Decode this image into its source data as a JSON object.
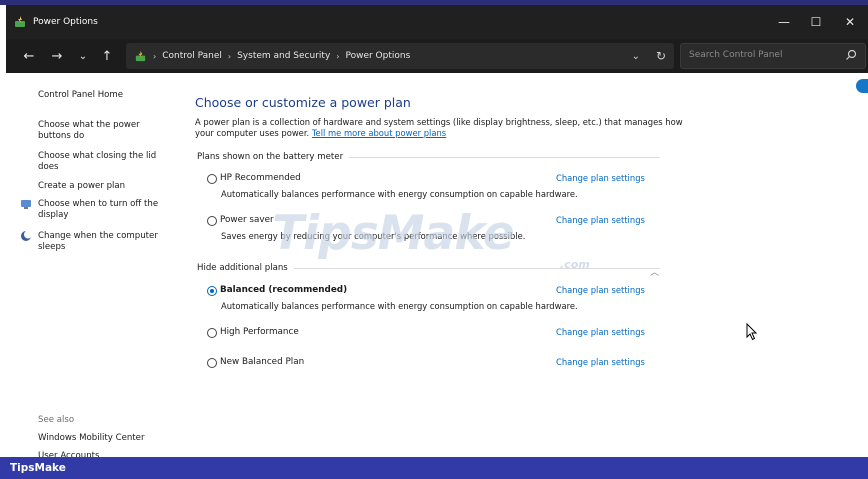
{
  "window": {
    "title": "Power Options",
    "min_glyph": "—",
    "max_glyph": "☐",
    "close_glyph": "✕"
  },
  "address_bar": {
    "breadcrumbs": [
      "Control Panel",
      "System and Security",
      "Power Options"
    ],
    "search_placeholder": "Search Control Panel"
  },
  "sidebar": {
    "home": "Control Panel Home",
    "links": [
      "Choose what the power buttons do",
      "Choose what closing the lid does",
      "Create a power plan",
      "Choose when to turn off the display",
      "Change when the computer sleeps"
    ],
    "see_also": "See also",
    "see_also_links": [
      "Windows Mobility Center",
      "User Accounts"
    ]
  },
  "main": {
    "title": "Choose or customize a power plan",
    "description": "A power plan is a collection of hardware and system settings (like display brightness, sleep, etc.) that manages how your computer uses power.",
    "tell_me_link": "Tell me more about power plans",
    "battery_section": "Plans shown on the battery meter",
    "hidden_section": "Hide additional plans",
    "change_label": "Change plan settings",
    "plans": [
      {
        "name": "HP Recommended",
        "desc": "Automatically balances performance with energy consumption on capable hardware.",
        "selected": false
      },
      {
        "name": "Power saver",
        "desc": "Saves energy by reducing your computer's performance where possible.",
        "selected": false
      },
      {
        "name": "Balanced (recommended)",
        "desc": "Automatically balances performance with energy consumption on capable hardware.",
        "selected": true
      },
      {
        "name": "High Performance",
        "desc": "",
        "selected": false
      },
      {
        "name": "New Balanced Plan",
        "desc": "",
        "selected": false
      }
    ]
  },
  "watermark": {
    "brand": "TipsMake",
    "suffix": ".com"
  },
  "bottom_bar": {
    "brand": "TipsMake"
  },
  "colors": {
    "accent": "#0067c0",
    "title_blue": "#1e3e8a",
    "titlebar": "#202020",
    "bottom_bar": "#323aa8"
  }
}
